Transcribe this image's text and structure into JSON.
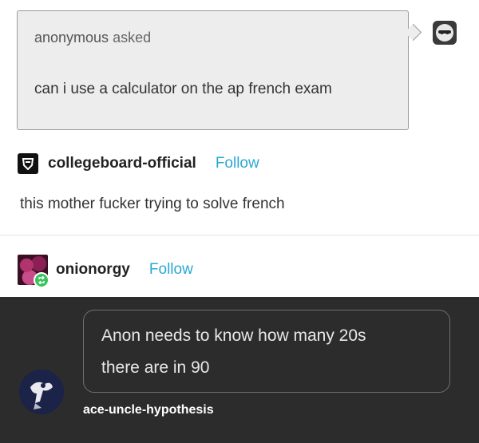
{
  "ask": {
    "asker": "anonymous",
    "asked_label": "asked",
    "question": "can i use a calculator on the ap french exam"
  },
  "reblogs": [
    {
      "blog": "collegeboard-official",
      "follow": "Follow",
      "text": "this mother fucker trying to solve french"
    },
    {
      "blog": "onionorgy",
      "follow": "Follow"
    }
  ],
  "reply": {
    "line1": "Anon needs to know how many 20s",
    "line2": "there are in 90",
    "author": "ace-uncle-hypothesis"
  },
  "colors": {
    "follow": "#2aa8d4",
    "reblog_badge": "#38c45a",
    "dark_bg": "#2c2c2c"
  }
}
